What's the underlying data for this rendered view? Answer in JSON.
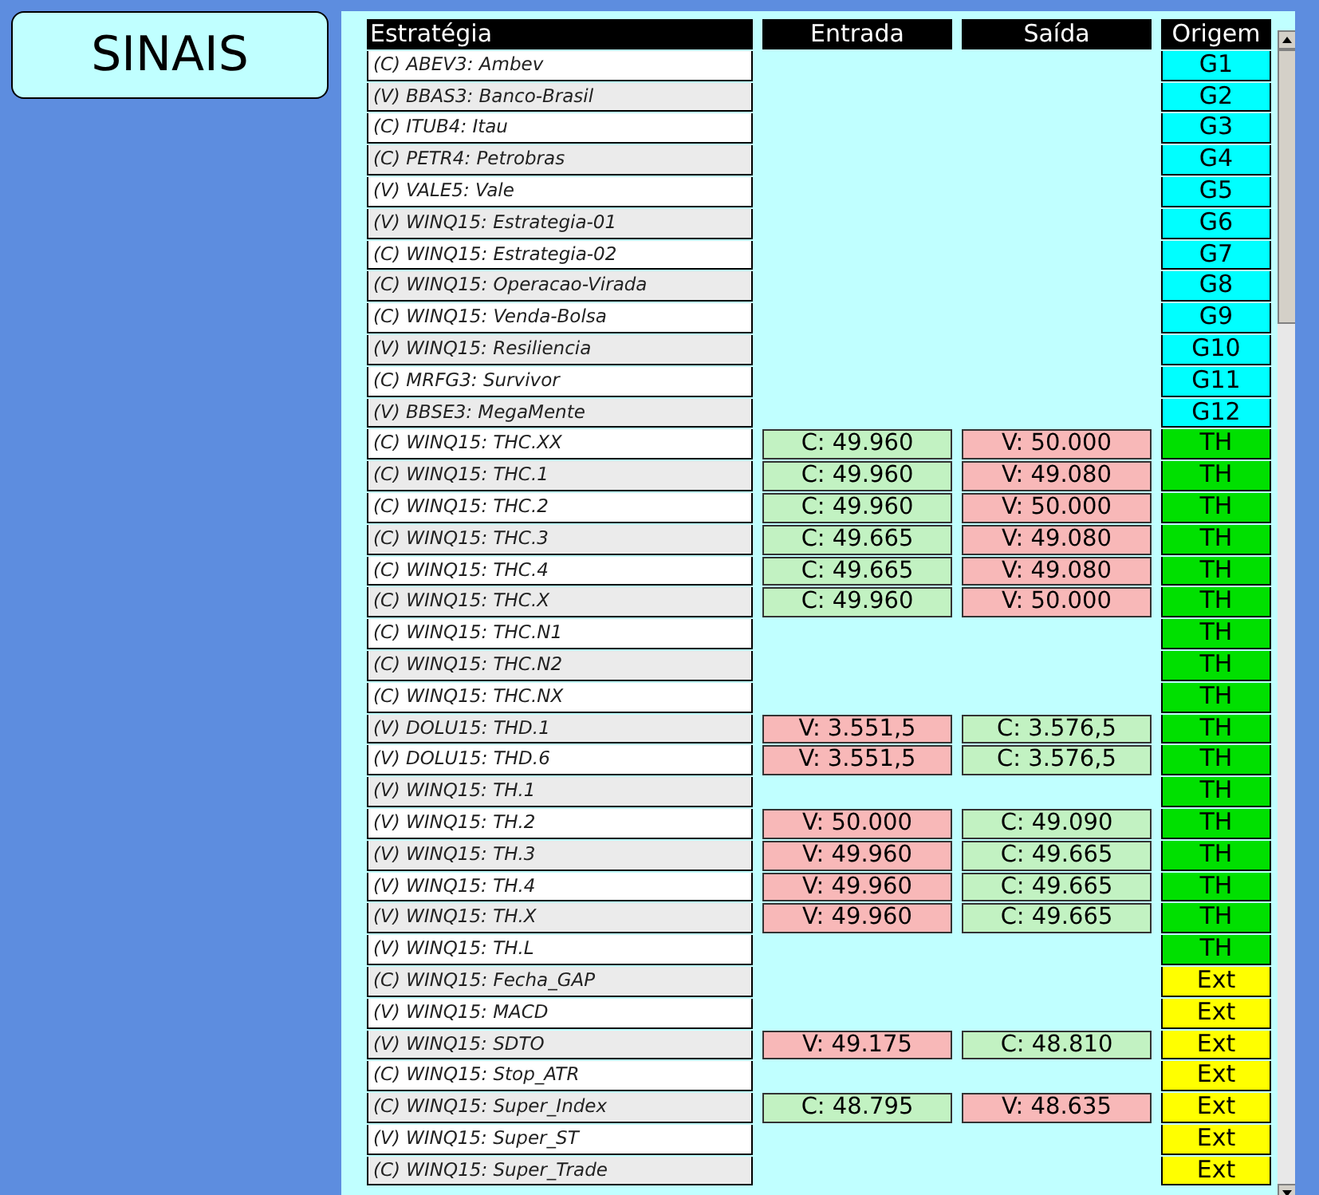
{
  "title_button": "SINAIS",
  "columns": [
    "Estratégia",
    "Entrada",
    "Saída",
    "Origem"
  ],
  "rows": [
    {
      "strategy": "(C) ABEV3: Ambev",
      "origin": {
        "text": "G1",
        "color": "#00ffff"
      }
    },
    {
      "strategy": "(V) BBAS3: Banco-Brasil",
      "origin": {
        "text": "G2",
        "color": "#00ffff"
      }
    },
    {
      "strategy": "(C) ITUB4: Itau",
      "origin": {
        "text": "G3",
        "color": "#00ffff"
      }
    },
    {
      "strategy": "(C) PETR4: Petrobras",
      "origin": {
        "text": "G4",
        "color": "#00ffff"
      }
    },
    {
      "strategy": "(V) VALE5: Vale",
      "origin": {
        "text": "G5",
        "color": "#00ffff"
      }
    },
    {
      "strategy": "(V) WINQ15: Estrategia-01",
      "origin": {
        "text": "G6",
        "color": "#00ffff"
      }
    },
    {
      "strategy": "(C) WINQ15: Estrategia-02",
      "origin": {
        "text": "G7",
        "color": "#00ffff"
      }
    },
    {
      "strategy": "(C) WINQ15: Operacao-Virada",
      "origin": {
        "text": "G8",
        "color": "#00ffff"
      }
    },
    {
      "strategy": "(C) WINQ15: Venda-Bolsa",
      "origin": {
        "text": "G9",
        "color": "#00ffff"
      }
    },
    {
      "strategy": "(V) WINQ15: Resiliencia",
      "origin": {
        "text": "G10",
        "color": "#00ffff"
      }
    },
    {
      "strategy": "(C) MRFG3: Survivor",
      "origin": {
        "text": "G11",
        "color": "#00ffff"
      }
    },
    {
      "strategy": "(V) BBSE3: MegaMente",
      "origin": {
        "text": "G12",
        "color": "#00ffff"
      }
    },
    {
      "strategy": "(C) WINQ15: THC.XX",
      "entry": {
        "text": "C: 49.960",
        "kind": "buy"
      },
      "exit": {
        "text": "V: 50.000",
        "kind": "sell"
      },
      "origin": {
        "text": "TH",
        "color": "#00e000"
      }
    },
    {
      "strategy": "(C) WINQ15: THC.1",
      "entry": {
        "text": "C: 49.960",
        "kind": "buy"
      },
      "exit": {
        "text": "V: 49.080",
        "kind": "sell"
      },
      "origin": {
        "text": "TH",
        "color": "#00e000"
      }
    },
    {
      "strategy": "(C) WINQ15: THC.2",
      "entry": {
        "text": "C: 49.960",
        "kind": "buy"
      },
      "exit": {
        "text": "V: 50.000",
        "kind": "sell"
      },
      "origin": {
        "text": "TH",
        "color": "#00e000"
      }
    },
    {
      "strategy": "(C) WINQ15: THC.3",
      "entry": {
        "text": "C: 49.665",
        "kind": "buy"
      },
      "exit": {
        "text": "V: 49.080",
        "kind": "sell"
      },
      "origin": {
        "text": "TH",
        "color": "#00e000"
      }
    },
    {
      "strategy": "(C) WINQ15: THC.4",
      "entry": {
        "text": "C: 49.665",
        "kind": "buy"
      },
      "exit": {
        "text": "V: 49.080",
        "kind": "sell"
      },
      "origin": {
        "text": "TH",
        "color": "#00e000"
      }
    },
    {
      "strategy": "(C) WINQ15: THC.X",
      "entry": {
        "text": "C: 49.960",
        "kind": "buy"
      },
      "exit": {
        "text": "V: 50.000",
        "kind": "sell"
      },
      "origin": {
        "text": "TH",
        "color": "#00e000"
      }
    },
    {
      "strategy": "(C) WINQ15: THC.N1",
      "origin": {
        "text": "TH",
        "color": "#00e000"
      }
    },
    {
      "strategy": "(C) WINQ15: THC.N2",
      "origin": {
        "text": "TH",
        "color": "#00e000"
      }
    },
    {
      "strategy": "(C) WINQ15: THC.NX",
      "origin": {
        "text": "TH",
        "color": "#00e000"
      }
    },
    {
      "strategy": "(V) DOLU15: THD.1",
      "entry": {
        "text": "V: 3.551,5",
        "kind": "sell"
      },
      "exit": {
        "text": "C: 3.576,5",
        "kind": "buy"
      },
      "origin": {
        "text": "TH",
        "color": "#00e000"
      }
    },
    {
      "strategy": "(V) DOLU15: THD.6",
      "entry": {
        "text": "V: 3.551,5",
        "kind": "sell"
      },
      "exit": {
        "text": "C: 3.576,5",
        "kind": "buy"
      },
      "origin": {
        "text": "TH",
        "color": "#00e000"
      }
    },
    {
      "strategy": "(V) WINQ15: TH.1",
      "origin": {
        "text": "TH",
        "color": "#00e000"
      }
    },
    {
      "strategy": "(V) WINQ15: TH.2",
      "entry": {
        "text": "V: 50.000",
        "kind": "sell"
      },
      "exit": {
        "text": "C: 49.090",
        "kind": "buy"
      },
      "origin": {
        "text": "TH",
        "color": "#00e000"
      }
    },
    {
      "strategy": "(V) WINQ15: TH.3",
      "entry": {
        "text": "V: 49.960",
        "kind": "sell"
      },
      "exit": {
        "text": "C: 49.665",
        "kind": "buy"
      },
      "origin": {
        "text": "TH",
        "color": "#00e000"
      }
    },
    {
      "strategy": "(V) WINQ15: TH.4",
      "entry": {
        "text": "V: 49.960",
        "kind": "sell"
      },
      "exit": {
        "text": "C: 49.665",
        "kind": "buy"
      },
      "origin": {
        "text": "TH",
        "color": "#00e000"
      }
    },
    {
      "strategy": "(V) WINQ15: TH.X",
      "entry": {
        "text": "V: 49.960",
        "kind": "sell"
      },
      "exit": {
        "text": "C: 49.665",
        "kind": "buy"
      },
      "origin": {
        "text": "TH",
        "color": "#00e000"
      }
    },
    {
      "strategy": "(V) WINQ15: TH.L",
      "origin": {
        "text": "TH",
        "color": "#00e000"
      }
    },
    {
      "strategy": "(C) WINQ15: Fecha_GAP",
      "origin": {
        "text": "Ext",
        "color": "#ffff00"
      }
    },
    {
      "strategy": "(V) WINQ15: MACD",
      "origin": {
        "text": "Ext",
        "color": "#ffff00"
      }
    },
    {
      "strategy": "(V) WINQ15: SDTO",
      "entry": {
        "text": "V: 49.175",
        "kind": "sell"
      },
      "exit": {
        "text": "C: 48.810",
        "kind": "buy"
      },
      "origin": {
        "text": "Ext",
        "color": "#ffff00"
      }
    },
    {
      "strategy": "(C) WINQ15: Stop_ATR",
      "origin": {
        "text": "Ext",
        "color": "#ffff00"
      }
    },
    {
      "strategy": "(C) WINQ15: Super_Index",
      "entry": {
        "text": "C: 48.795",
        "kind": "buy"
      },
      "exit": {
        "text": "V: 48.635",
        "kind": "sell"
      },
      "origin": {
        "text": "Ext",
        "color": "#ffff00"
      }
    },
    {
      "strategy": "(V) WINQ15: Super_ST",
      "origin": {
        "text": "Ext",
        "color": "#ffff00"
      }
    },
    {
      "strategy": "(C) WINQ15: Super_Trade",
      "origin": {
        "text": "Ext",
        "color": "#ffff00"
      }
    }
  ]
}
